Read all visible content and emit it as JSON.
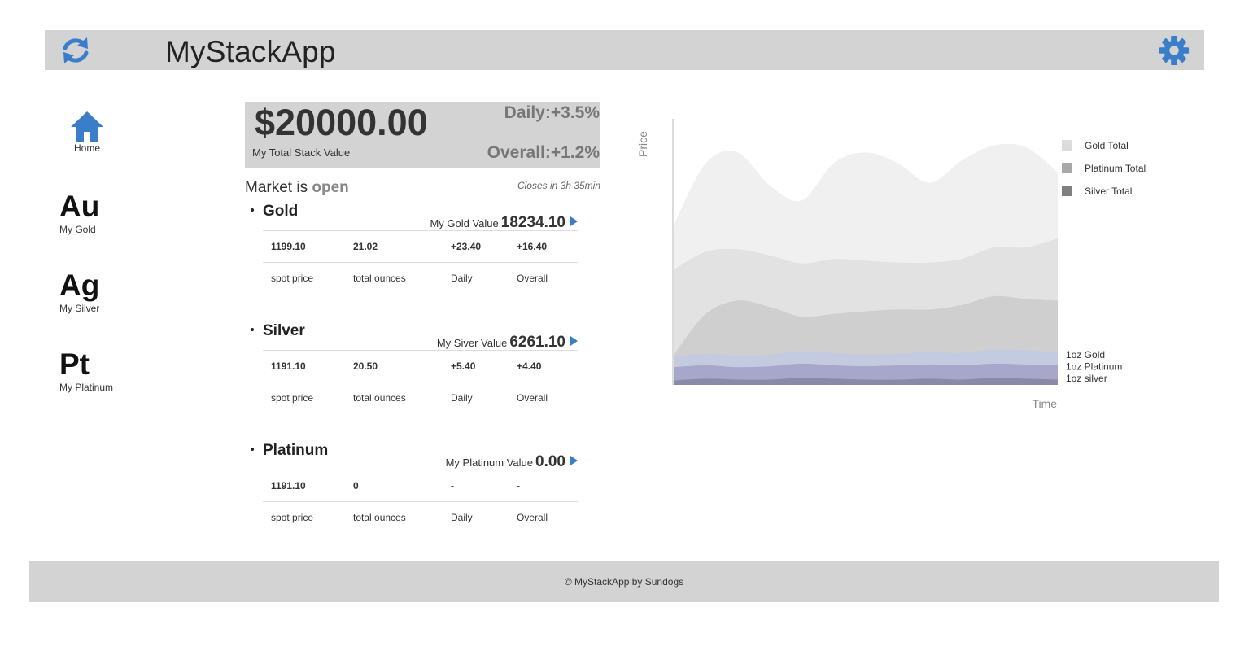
{
  "app": {
    "title": "MyStackApp"
  },
  "sidebar": {
    "home_label": "Home",
    "items": [
      {
        "symbol": "Au",
        "label": "My Gold"
      },
      {
        "symbol": "Ag",
        "label": "My Silver"
      },
      {
        "symbol": "Pt",
        "label": "My Platinum"
      }
    ]
  },
  "summary": {
    "total": "$20000.00",
    "total_label": "My Total Stack Value",
    "daily": "Daily:+3.5%",
    "overall": "Overall:+1.2%"
  },
  "market": {
    "prefix": "Market is",
    "state": "open",
    "closes": "Closes in 3h 35min"
  },
  "metals": [
    {
      "name": "Gold",
      "value_label": "My Gold Value",
      "value": "18234.10",
      "values": [
        "1199.10",
        "21.02",
        "+23.40",
        "+16.40"
      ],
      "labels": [
        "spot price",
        "total ounces",
        "Daily",
        "Overall"
      ]
    },
    {
      "name": "Silver",
      "value_label": "My Siver Value",
      "value": "6261.10",
      "values": [
        "1191.10",
        "20.50",
        "+5.40",
        "+4.40"
      ],
      "labels": [
        "spot price",
        "total ounces",
        "Daily",
        "Overall"
      ]
    },
    {
      "name": "Platinum",
      "value_label": "My Platinum Value",
      "value": "0.00",
      "values": [
        "1191.10",
        "0",
        "-",
        "-"
      ],
      "labels": [
        "spot price",
        "total ounces",
        "Daily",
        "Overall"
      ]
    }
  ],
  "chart_data": {
    "type": "area",
    "ylabel": "Price",
    "xlabel": "Time",
    "legend_position": "top-right",
    "legend": [
      {
        "name": "Gold Total",
        "color": "#dcdcdc"
      },
      {
        "name": "Platinum Total",
        "color": "#a9a9a9"
      },
      {
        "name": "Silver Total",
        "color": "#808080"
      }
    ],
    "line_labels": [
      "1oz Gold",
      "1oz Platinum",
      "1oz silver"
    ],
    "x": [
      0,
      1,
      2,
      3,
      4,
      5,
      6,
      7,
      8,
      9,
      10,
      11,
      12
    ],
    "series": [
      {
        "name": "Gold Total",
        "color": "#f0f0f0",
        "values": [
          180,
          250,
          262,
          225,
          208,
          250,
          262,
          250,
          228,
          253,
          270,
          268,
          240
        ]
      },
      {
        "name": "Platinum Total",
        "color": "#e2e2e2",
        "values": [
          130,
          150,
          153,
          146,
          137,
          142,
          140,
          138,
          138,
          142,
          155,
          155,
          165
        ]
      },
      {
        "name": "Silver Total",
        "color": "#cfcfcf",
        "values": [
          34,
          80,
          95,
          88,
          77,
          80,
          83,
          85,
          85,
          90,
          100,
          97,
          95
        ]
      },
      {
        "name": "1oz Gold",
        "color": "#c4cbe0",
        "values": [
          32,
          35,
          33,
          34,
          38,
          36,
          34,
          35,
          37,
          36,
          40,
          39,
          37
        ]
      },
      {
        "name": "1oz Platinum",
        "color": "#a7a7c9",
        "values": [
          20,
          22,
          20,
          21,
          24,
          22,
          21,
          22,
          23,
          22,
          24,
          23,
          22
        ]
      },
      {
        "name": "1oz silver",
        "color": "#8a8aa8",
        "values": [
          5,
          7,
          6,
          6,
          8,
          7,
          6,
          6,
          7,
          6,
          8,
          7,
          6
        ]
      }
    ],
    "ylim": [
      0,
      300
    ]
  }
}
